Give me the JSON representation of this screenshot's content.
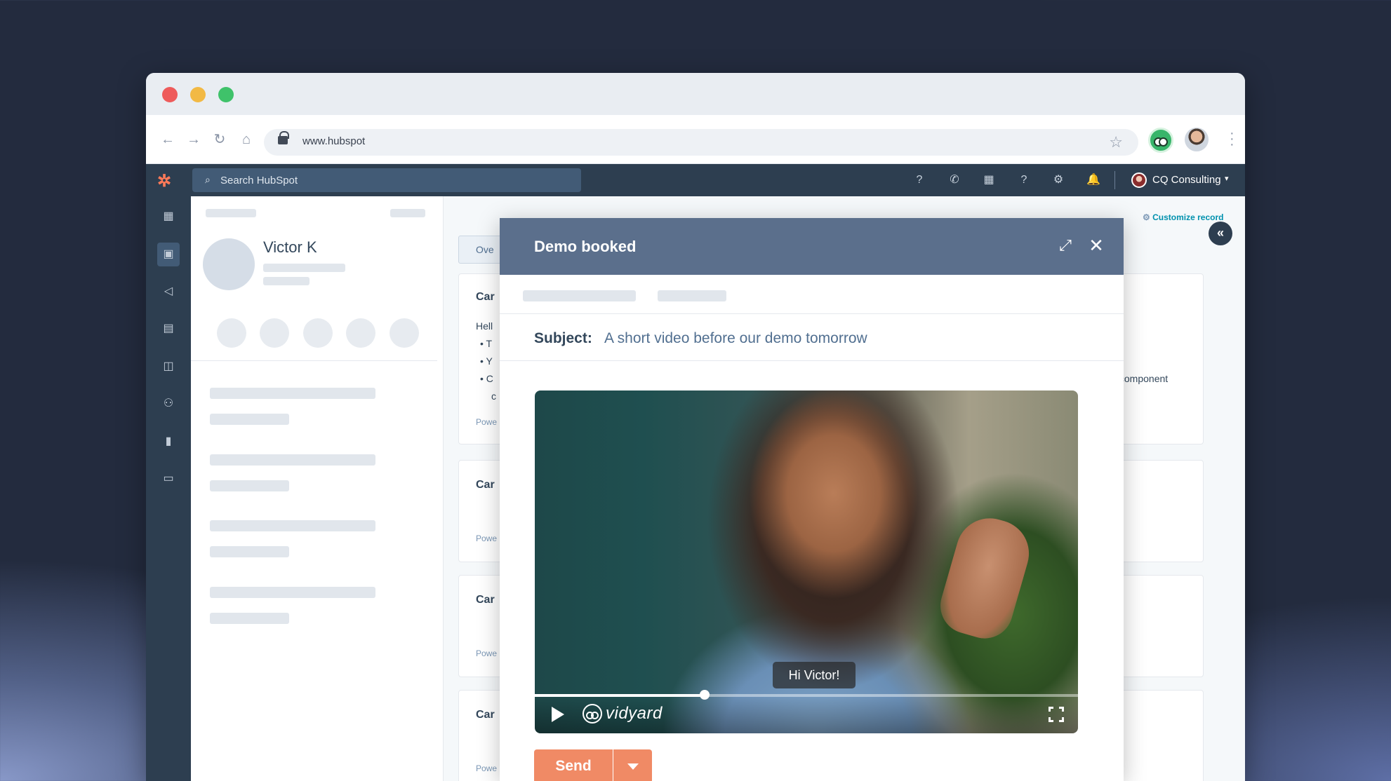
{
  "browser": {
    "url": "www.hubspot",
    "nav": {
      "back": "←",
      "forward": "→",
      "reload": "↻",
      "home": "⌂"
    },
    "bookmark_icon": "☆"
  },
  "hubspot": {
    "search_placeholder": "Search HubSpot",
    "search_icon": "⌕",
    "top_icons": [
      "?",
      "✆",
      "▦",
      "?",
      "⚙",
      "🔔"
    ],
    "account_name": "CQ Consulting",
    "account_caret": "▾",
    "sidebar_icons": [
      "▦",
      "▣",
      "◁",
      "▤",
      "◫",
      "⚇",
      "▮",
      "▭"
    ]
  },
  "record": {
    "contact_name": "Victor K",
    "customize_label": "Customize record",
    "tab_label": "Ove",
    "cards": [
      {
        "title": "Car",
        "small": "Powe"
      },
      {
        "title": "Car",
        "small": "Powe"
      },
      {
        "title": "Car",
        "small": "Powe"
      },
      {
        "title": "Car",
        "small": "Powe"
      }
    ],
    "card1_greeting": "Hell",
    "card1_bullets": [
      "• T",
      "• Y",
      "• C"
    ],
    "card1_extra": "c",
    "right_fragment": "s component",
    "collapse_icon": "«"
  },
  "modal": {
    "title": "Demo booked",
    "expand_icon": "⤢",
    "close_icon": "✕",
    "subject_label": "Subject:",
    "subject_value": "A short video before our demo tomorrow",
    "video": {
      "caption": "Hi Victor!",
      "brand": "vidyard",
      "progress_fraction": 0.313
    },
    "send_label": "Send"
  }
}
